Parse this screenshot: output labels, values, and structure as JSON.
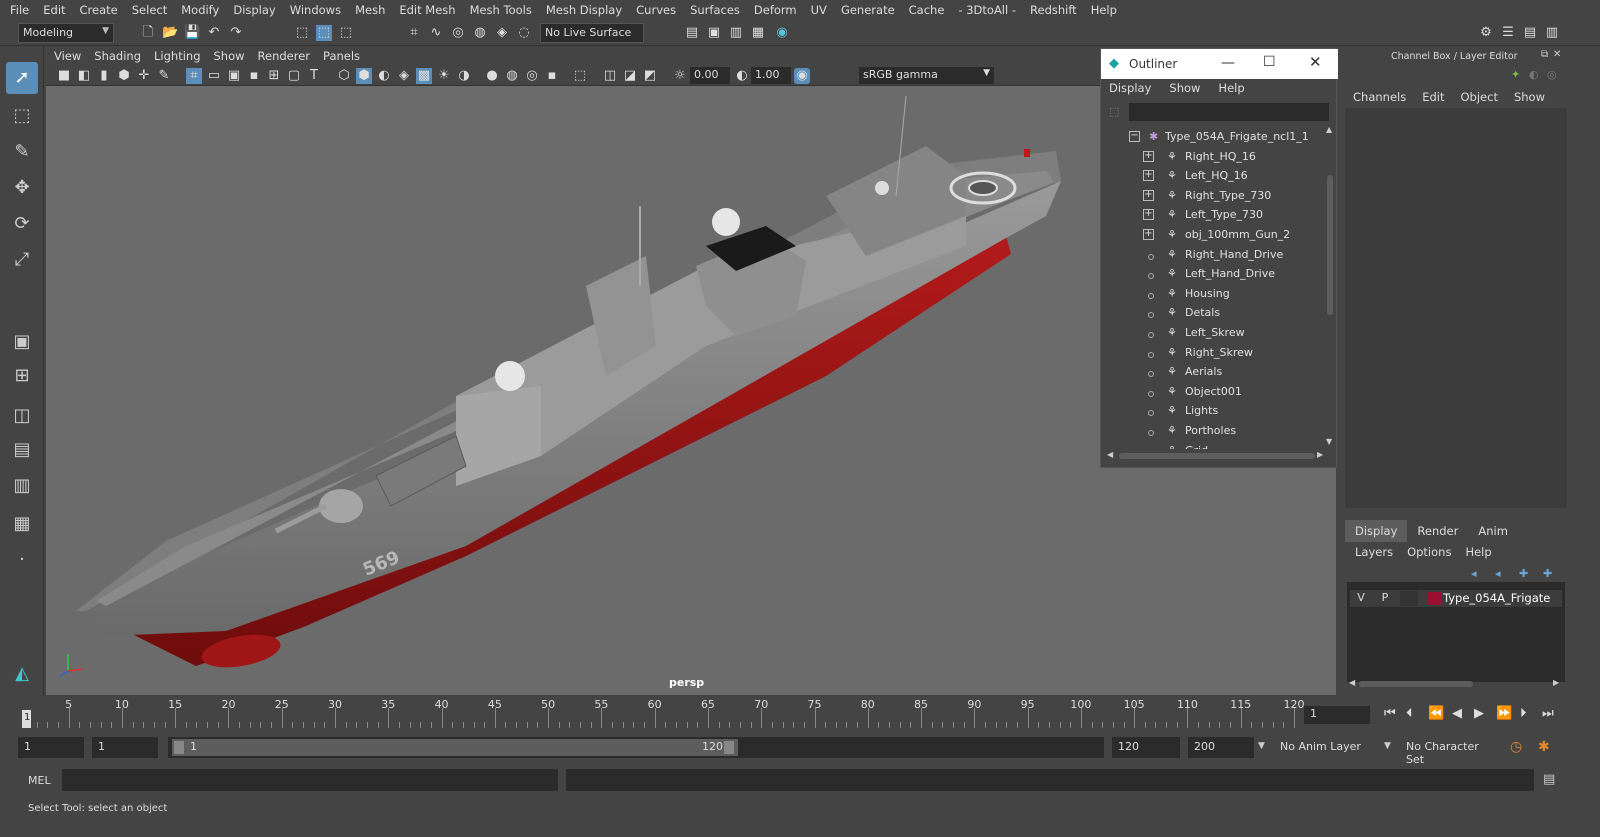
{
  "menubar": {
    "items": [
      "File",
      "Edit",
      "Create",
      "Select",
      "Modify",
      "Display",
      "Windows",
      "Mesh",
      "Edit Mesh",
      "Mesh Tools",
      "Mesh Display",
      "Curves",
      "Surfaces",
      "Deform",
      "UV",
      "Generate",
      "Cache",
      "- 3DtoAll -",
      "Redshift",
      "Help"
    ]
  },
  "shelf": {
    "mode": "Modeling",
    "live_surface": "No Live Surface"
  },
  "viewport": {
    "menu": [
      "View",
      "Shading",
      "Lighting",
      "Show",
      "Renderer",
      "Panels"
    ],
    "exposure": "0.00",
    "gamma": "1.00",
    "color_space": "sRGB gamma",
    "camera_label": "persp",
    "hull_number": "569"
  },
  "outliner": {
    "title": "Outliner",
    "menu": [
      "Display",
      "Show",
      "Help"
    ],
    "root": "Type_054A_Frigate_ncl1_1",
    "items": [
      {
        "label": "Right_HQ_16",
        "expandable": true
      },
      {
        "label": "Left_HQ_16",
        "expandable": true
      },
      {
        "label": "Right_Type_730",
        "expandable": true
      },
      {
        "label": "Left_Type_730",
        "expandable": true
      },
      {
        "label": "obj_100mm_Gun_2",
        "expandable": true
      },
      {
        "label": "Right_Hand_Drive",
        "expandable": false
      },
      {
        "label": "Left_Hand_Drive",
        "expandable": false
      },
      {
        "label": "Housing",
        "expandable": false
      },
      {
        "label": "Detals",
        "expandable": false
      },
      {
        "label": "Left_Skrew",
        "expandable": false
      },
      {
        "label": "Right_Skrew",
        "expandable": false
      },
      {
        "label": "Aerials",
        "expandable": false
      },
      {
        "label": "Object001",
        "expandable": false
      },
      {
        "label": "Lights",
        "expandable": false
      },
      {
        "label": "Portholes",
        "expandable": false
      },
      {
        "label": "Grid",
        "expandable": false
      }
    ]
  },
  "channel_box": {
    "title": "Channel Box / Layer Editor",
    "menu": [
      "Channels",
      "Edit",
      "Object",
      "Show"
    ]
  },
  "layer_editor": {
    "tabs": [
      "Display",
      "Render",
      "Anim"
    ],
    "menu": [
      "Layers",
      "Options",
      "Help"
    ],
    "layer": {
      "v": "V",
      "p": "P",
      "name": "Type_054A_Frigate",
      "color": "#9b1030"
    }
  },
  "timeline": {
    "ticks": [
      "5",
      "10",
      "15",
      "20",
      "25",
      "30",
      "35",
      "40",
      "45",
      "50",
      "55",
      "60",
      "65",
      "70",
      "75",
      "80",
      "85",
      "90",
      "95",
      "100",
      "105",
      "110",
      "115",
      "120"
    ],
    "start_marker": "1",
    "current_frame": "1"
  },
  "range": {
    "start": "1",
    "playback_start": "1",
    "slider_start": "1",
    "slider_end": "120",
    "playback_end": "120",
    "end": "200",
    "anim_layer": "No Anim Layer",
    "character_set": "No Character Set"
  },
  "command": {
    "label": "MEL"
  },
  "help_line": "Select Tool: select an object",
  "colors": {
    "accent": "#5b8fb9",
    "viewport_bg": "#6b6b6b",
    "hull_red": "#b21a1a",
    "hull_grey": "#8d8d8d"
  }
}
